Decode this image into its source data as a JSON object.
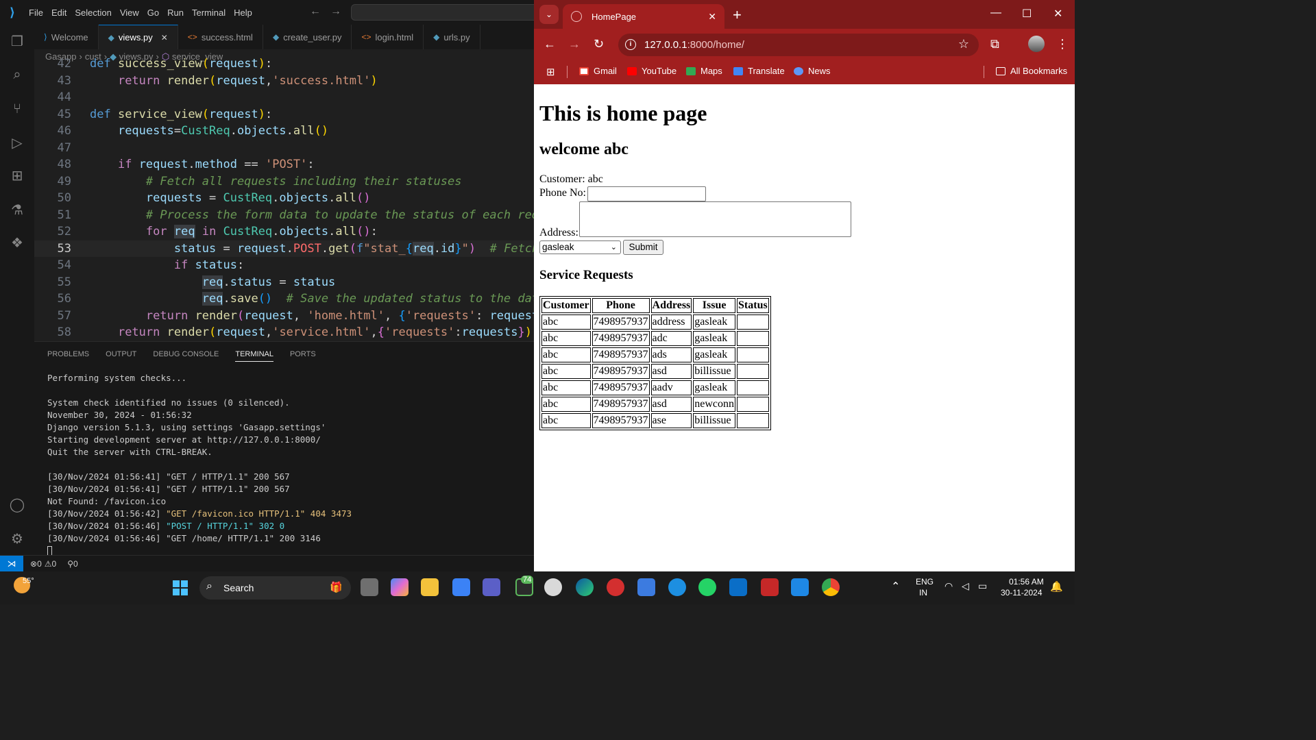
{
  "vscode": {
    "menu": [
      "File",
      "Edit",
      "Selection",
      "View",
      "Go",
      "Run",
      "Terminal",
      "Help"
    ],
    "tabs": [
      {
        "label": "Welcome",
        "icon": "vscode-icon",
        "active": false
      },
      {
        "label": "views.py",
        "icon": "python-icon",
        "active": true
      },
      {
        "label": "success.html",
        "icon": "html-icon",
        "active": false
      },
      {
        "label": "create_user.py",
        "icon": "python-icon",
        "active": false
      },
      {
        "label": "login.html",
        "icon": "html-icon",
        "active": false
      },
      {
        "label": "urls.py",
        "icon": "python-icon",
        "active": false
      }
    ],
    "breadcrumb": [
      "Gasapp",
      "cust",
      "views.py",
      "service_view"
    ],
    "code_lines": [
      42,
      43,
      44,
      45,
      46,
      47,
      48,
      49,
      50,
      51,
      52,
      53,
      54,
      55,
      56,
      57,
      58
    ],
    "panel_tabs": [
      "PROBLEMS",
      "OUTPUT",
      "DEBUG CONSOLE",
      "TERMINAL",
      "PORTS"
    ],
    "terminal": {
      "l1": "Performing system checks...",
      "l2": "System check identified no issues (0 silenced).",
      "l3": "November 30, 2024 - 01:56:32",
      "l4": "Django version 5.1.3, using settings 'Gasapp.settings'",
      "l5": "Starting development server at http://127.0.0.1:8000/",
      "l6": "Quit the server with CTRL-BREAK.",
      "l7": "[30/Nov/2024 01:56:41] \"GET / HTTP/1.1\" 200 567",
      "l8": "[30/Nov/2024 01:56:41] \"GET / HTTP/1.1\" 200 567",
      "l9": "Not Found: /favicon.ico",
      "l10_prefix": "[30/Nov/2024 01:56:42] ",
      "l10_msg": "\"GET /favicon.ico HTTP/1.1\" 404 3473",
      "l11_prefix": "[30/Nov/2024 01:56:46] ",
      "l11_msg": "\"POST / HTTP/1.1\" 302 0",
      "l12": "[30/Nov/2024 01:56:46] \"GET /home/ HTTP/1.1\" 200 3146"
    },
    "status": {
      "errors": "0",
      "warnings": "0",
      "ports": "0"
    }
  },
  "chrome": {
    "tab_title": "HomePage",
    "url_host": "127.0.0.1",
    "url_path": ":8000/home/",
    "bookmarks": [
      "Gmail",
      "YouTube",
      "Maps",
      "Translate",
      "News"
    ],
    "all_bookmarks": "All Bookmarks",
    "accent": "#a11f1f"
  },
  "page": {
    "h1": "This is home page",
    "h2": "welcome abc",
    "customer": "Customer: abc",
    "phone_label": "Phone No:",
    "address_label": "Address:",
    "select_value": "gasleak",
    "submit": "Submit",
    "h3": "Service Requests",
    "headers": [
      "Customer",
      "Phone",
      "Address",
      "Issue",
      "Status"
    ],
    "rows": [
      [
        "abc",
        "7498957937",
        "address",
        "gasleak",
        ""
      ],
      [
        "abc",
        "7498957937",
        "adc",
        "gasleak",
        ""
      ],
      [
        "abc",
        "7498957937",
        "ads",
        "gasleak",
        ""
      ],
      [
        "abc",
        "7498957937",
        "asd",
        "billissue",
        ""
      ],
      [
        "abc",
        "7498957937",
        "aadv",
        "gasleak",
        ""
      ],
      [
        "abc",
        "7498957937",
        "asd",
        "newconn",
        ""
      ],
      [
        "abc",
        "7498957937",
        "ase",
        "billissue",
        ""
      ]
    ]
  },
  "taskbar": {
    "weather": "55°",
    "search": "Search",
    "badge": "74",
    "lang1": "ENG",
    "lang2": "IN",
    "time": "01:56 AM",
    "date": "30-11-2024"
  }
}
